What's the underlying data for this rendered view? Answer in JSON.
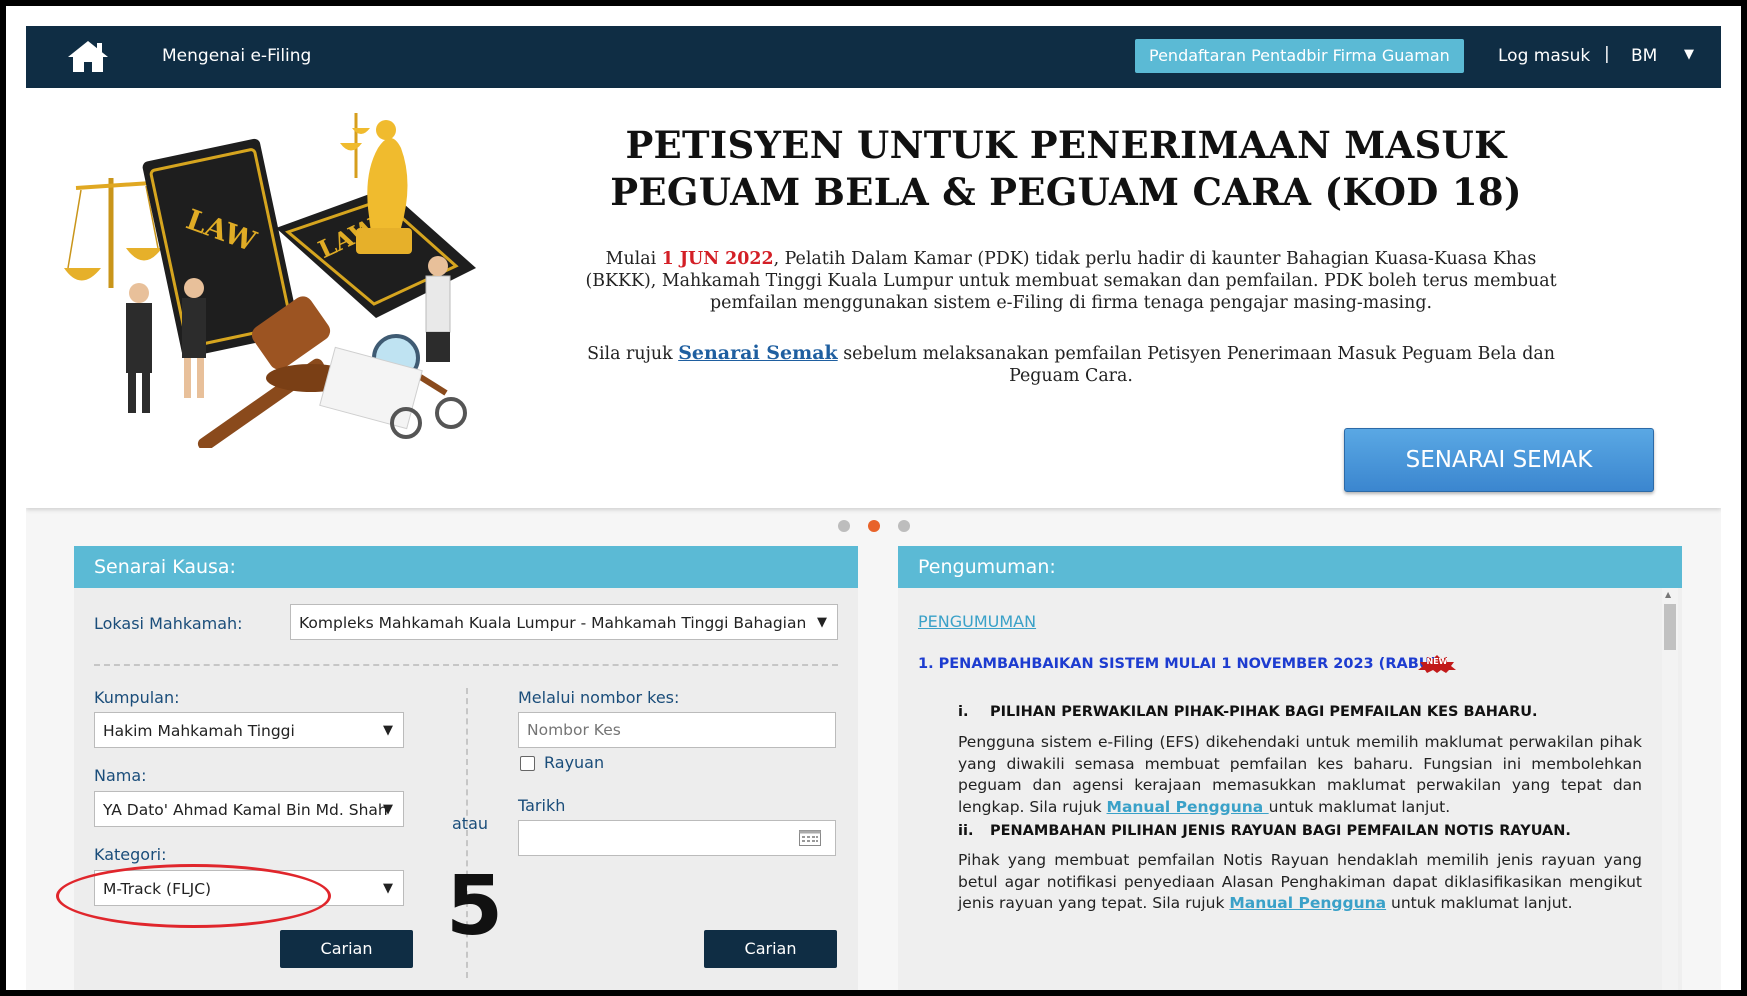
{
  "nav": {
    "about": "Mengenai e-Filing",
    "register": "Pendaftaran Pentadbir Firma Guaman",
    "login": "Log masuk",
    "separator": "|",
    "lang": "BM",
    "lang_caret": "▼"
  },
  "banner": {
    "title_line1": "PETISYEN UNTUK PENERIMAAN MASUK",
    "title_line2": "PEGUAM BELA & PEGUAM CARA (KOD 18)",
    "p1_prefix": "Mulai ",
    "p1_date": "1 JUN 2022",
    "p1_rest": ", Pelatih Dalam Kamar (PDK) tidak perlu hadir di kaunter Bahagian Kuasa-Kuasa Khas (BKKK), Mahkamah Tinggi Kuala Lumpur untuk membuat semakan dan pemfailan. PDK boleh terus membuat pemfailan menggunakan sistem e-Filing di firma tenaga pengajar masing-masing.",
    "p2_prefix": "Sila rujuk ",
    "p2_link": "Senarai Semak",
    "p2_rest": " sebelum melaksanakan pemfailan Petisyen Penerimaan Masuk Peguam Bela dan Peguam Cara.",
    "button": "SENARAI SEMAK",
    "illustration_text_1": "LAW",
    "illustration_text_2": "LAW"
  },
  "carousel": {
    "count": 3,
    "active": 2
  },
  "kausa": {
    "header": "Senarai Kausa:",
    "lokasi_label": "Lokasi Mahkamah:",
    "lokasi_value": "Kompleks Mahkamah Kuala Lumpur - Mahkamah Tinggi Bahagian",
    "kumpulan_label": "Kumpulan:",
    "kumpulan_value": "Hakim Mahkamah Tinggi",
    "nama_label": "Nama:",
    "nama_value": "YA Dato' Ahmad Kamal Bin Md. Shah",
    "kategori_label": "Kategori:",
    "kategori_value": "M-Track (FLJC)",
    "atau": "atau",
    "nombor_label": "Melalui nombor kes:",
    "nombor_placeholder": "Nombor Kes",
    "rayuan_label": "Rayuan",
    "tarikh_label": "Tarikh",
    "search_btn": "Carian"
  },
  "annotation": {
    "step": "5"
  },
  "pengumuman": {
    "header": "Pengumuman:",
    "link": "PENGUMUMAN",
    "item1_title": "1. PENAMBAHBAIKAN SISTEM MULAI 1 NOVEMBER 2023 (RABU) .",
    "new_badge": "NEW",
    "i_num": "i.",
    "i_title": "PILIHAN PERWAKILAN PIHAK-PIHAK BAGI PEMFAILAN KES BAHARU.",
    "i_text": "Pengguna sistem e-Filing (EFS) dikehendaki untuk memilih maklumat perwakilan pihak yang diwakili semasa membuat pemfailan kes baharu. Fungsian ini membolehkan peguam dan agensi kerajaan memasukkan maklumat perwakilan yang tepat dan lengkap. Sila rujuk ",
    "i_link": "Manual Pengguna ",
    "i_suffix": "untuk maklumat lanjut.",
    "ii_num": "ii.",
    "ii_title": "PENAMBAHAN PILIHAN JENIS RAYUAN BAGI PEMFAILAN NOTIS RAYUAN.",
    "ii_text": "Pihak yang membuat pemfailan Notis Rayuan hendaklah memilih jenis rayuan yang betul agar notifikasi penyediaan Alasan Penghakiman dapat diklasifikasikan mengikut jenis rayuan yang tepat. Sila rujuk ",
    "ii_link": "Manual Pengguna",
    "ii_suffix": " untuk maklumat lanjut."
  },
  "colors": {
    "navbar": "#0f2d44",
    "panel_header": "#5bbad5",
    "accent_orange": "#e8632a",
    "annotation_red": "#e0262c"
  }
}
